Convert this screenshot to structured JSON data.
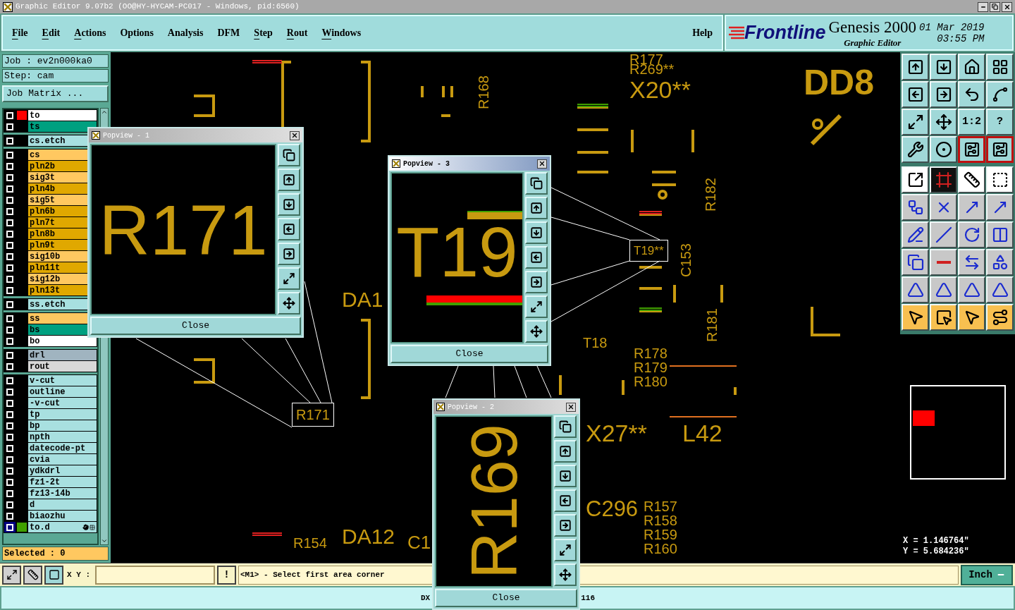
{
  "window": {
    "title": "Graphic Editor 9.07b2 (OO@HY-HYCAM-PC017 - Windows, pid:6560)"
  },
  "menu": [
    {
      "label": "File",
      "underlined": true
    },
    {
      "label": "Edit",
      "underlined": true
    },
    {
      "label": "Actions",
      "underlined": true
    },
    {
      "label": "Options",
      "underlined": false
    },
    {
      "label": "Analysis",
      "underlined": false
    },
    {
      "label": "DFM",
      "underlined": false
    },
    {
      "label": "Step",
      "underlined": true
    },
    {
      "label": "Rout",
      "underlined": true
    },
    {
      "label": "Windows",
      "underlined": true
    }
  ],
  "help": "Help",
  "brand": {
    "logo": "Frontline",
    "product": "Genesis 2000",
    "subtitle": "Graphic Editor",
    "date": "01 Mar 2019",
    "time": "03:55 PM"
  },
  "job": {
    "job": "Job : ev2n000ka0",
    "step": "Step: cam",
    "matrix_button": "Job Matrix ..."
  },
  "layer_groups": [
    [
      {
        "name": "to",
        "color": "#ffffff",
        "marker": {
          "color": "#ff0000"
        },
        "selected": false
      },
      {
        "name": "ts",
        "color": "#00a080",
        "selected": false
      }
    ],
    [
      {
        "name": "cs.etch",
        "color": "#a8e0e0",
        "selected": false
      }
    ],
    [
      {
        "name": "cs",
        "color": "#ffc860",
        "selected": false
      },
      {
        "name": "pln2b",
        "color": "#e0a800",
        "selected": false
      },
      {
        "name": "sig3t",
        "color": "#ffc860",
        "selected": false
      },
      {
        "name": "pln4b",
        "color": "#e0a800",
        "selected": false
      },
      {
        "name": "sig5t",
        "color": "#ffc860",
        "selected": false
      },
      {
        "name": "pln6b",
        "color": "#e0a800",
        "selected": false
      },
      {
        "name": "pln7t",
        "color": "#e0a800",
        "selected": false
      },
      {
        "name": "pln8b",
        "color": "#e0a800",
        "selected": false
      },
      {
        "name": "pln9t",
        "color": "#e0a800",
        "selected": false
      },
      {
        "name": "sig10b",
        "color": "#ffc860",
        "selected": false
      },
      {
        "name": "pln11t",
        "color": "#e0a800",
        "selected": false
      },
      {
        "name": "sig12b",
        "color": "#ffc860",
        "selected": false
      },
      {
        "name": "pln13t",
        "color": "#e0a800",
        "selected": false
      }
    ],
    [
      {
        "name": "ss.etch",
        "color": "#a8e0e0",
        "selected": false
      }
    ],
    [
      {
        "name": "ss",
        "color": "#ffc860",
        "selected": false
      },
      {
        "name": "bs",
        "color": "#00a080",
        "selected": false
      },
      {
        "name": "bo",
        "color": "#ffffff",
        "selected": false
      }
    ],
    [
      {
        "name": "drl",
        "color": "#a0b4c0",
        "selected": false
      },
      {
        "name": "rout",
        "color": "#d8d8d8",
        "selected": false
      }
    ],
    [
      {
        "name": "v-cut",
        "color": "#a8e0e0",
        "selected": false
      },
      {
        "name": "outline",
        "color": "#a8e0e0",
        "selected": false
      },
      {
        "name": "-v-cut",
        "color": "#a8e0e0",
        "selected": false
      },
      {
        "name": "tp",
        "color": "#a8e0e0",
        "selected": false
      },
      {
        "name": "bp",
        "color": "#a8e0e0",
        "selected": false
      },
      {
        "name": "npth",
        "color": "#a8e0e0",
        "selected": false
      },
      {
        "name": "datecode-pt",
        "color": "#a8e0e0",
        "selected": false
      },
      {
        "name": "cvia",
        "color": "#a8e0e0",
        "selected": false
      },
      {
        "name": "ydkdrl",
        "color": "#a8e0e0",
        "selected": false
      },
      {
        "name": "fz1-2t",
        "color": "#a8e0e0",
        "selected": false
      },
      {
        "name": "fz13-14b",
        "color": "#a8e0e0",
        "selected": false
      },
      {
        "name": "d",
        "color": "#a8e0e0",
        "selected": false
      },
      {
        "name": "biaozhu",
        "color": "#a8e0e0",
        "selected": false
      },
      {
        "name": "to.d",
        "color": "#a8e0e0",
        "marker": {
          "color": "#40a000"
        },
        "selected": true
      }
    ]
  ],
  "selected_count": "Selected : 0",
  "canvas_labels": [
    {
      "text": "R177"
    },
    {
      "text": "R269**"
    },
    {
      "text": "X20**"
    },
    {
      "text": "DD8"
    },
    {
      "text": "R168"
    },
    {
      "text": "R182"
    },
    {
      "text": "C153"
    },
    {
      "text": "R181"
    },
    {
      "text": "T19**"
    },
    {
      "text": "T18"
    },
    {
      "text": "R178"
    },
    {
      "text": "R179"
    },
    {
      "text": "R180"
    },
    {
      "text": "X27**"
    },
    {
      "text": "L42"
    },
    {
      "text": "C296"
    },
    {
      "text": "R157"
    },
    {
      "text": "R158"
    },
    {
      "text": "R154"
    },
    {
      "text": "DA12"
    },
    {
      "text": "C1"
    },
    {
      "text": "R159"
    },
    {
      "text": "R160"
    },
    {
      "text": "DA1"
    },
    {
      "text": "R171"
    }
  ],
  "popviews": [
    {
      "title": "Popview - 1",
      "content": "R171",
      "close": "Close",
      "active": false
    },
    {
      "title": "Popview - 3",
      "content": "T19",
      "close": "Close",
      "active": true
    },
    {
      "title": "Popview - 2",
      "content": "R169",
      "close": "Close",
      "active": false
    }
  ],
  "toolbar": [
    {
      "kind": "teal",
      "active": false
    },
    {
      "kind": "teal",
      "active": false
    },
    {
      "kind": "teal",
      "active": false
    },
    {
      "kind": "teal",
      "active": false
    },
    {
      "kind": "teal",
      "active": false
    },
    {
      "kind": "teal",
      "active": false
    },
    {
      "kind": "teal",
      "active": false
    },
    {
      "kind": "teal",
      "active": false
    },
    {
      "kind": "teal",
      "active": false
    },
    {
      "kind": "teal",
      "active": false
    },
    {
      "kind": "teal",
      "active": false,
      "label": "1:2"
    },
    {
      "kind": "teal",
      "active": false,
      "label": "?"
    },
    {
      "kind": "teal",
      "active": false
    },
    {
      "kind": "teal",
      "active": false
    },
    {
      "kind": "teal",
      "active": true
    },
    {
      "kind": "teal",
      "active": true
    },
    {
      "kind": "white",
      "active": false
    },
    {
      "kind": "dark",
      "active": false
    },
    {
      "kind": "white",
      "active": false
    },
    {
      "kind": "white",
      "active": false
    },
    {
      "kind": "gray",
      "active": false
    },
    {
      "kind": "gray",
      "active": false
    },
    {
      "kind": "gray",
      "active": false
    },
    {
      "kind": "gray",
      "active": false
    },
    {
      "kind": "gray",
      "active": false
    },
    {
      "kind": "gray",
      "active": false
    },
    {
      "kind": "gray",
      "active": false
    },
    {
      "kind": "gray",
      "active": false
    },
    {
      "kind": "gray",
      "active": false
    },
    {
      "kind": "gray",
      "active": false
    },
    {
      "kind": "gray",
      "active": false
    },
    {
      "kind": "gray",
      "active": false
    },
    {
      "kind": "gray",
      "active": false
    },
    {
      "kind": "gray",
      "active": false
    },
    {
      "kind": "gray",
      "active": false
    },
    {
      "kind": "gray",
      "active": false
    },
    {
      "kind": "orange",
      "active": false
    },
    {
      "kind": "orange",
      "active": false
    },
    {
      "kind": "orange",
      "active": false
    },
    {
      "kind": "orange",
      "active": false
    }
  ],
  "coordinates": {
    "x": "X = 1.146764\"",
    "y": "Y = 5.684236\""
  },
  "command_bar": {
    "xy_label": "X Y :",
    "bang": "!",
    "message": "<M1> - Select first area corner",
    "units": "Inch"
  },
  "status_bar": [
    "DX",
    "116"
  ]
}
